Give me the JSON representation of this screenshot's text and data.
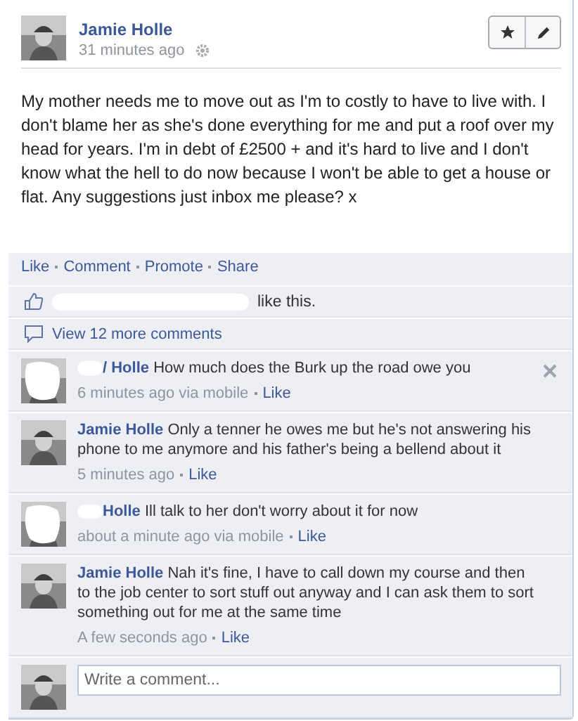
{
  "post": {
    "author": "Jamie Holle",
    "time": "31 minutes ago",
    "body": "My mother needs me to move out as I'm to costly to have to live with. I don't blame her as she's done everything for me and put a roof over my head for years. I'm in debt of £2500 + and it's hard to live and I don't know what the hell to do now because I won't be able to get a house or flat. Any suggestions just inbox me please? x"
  },
  "actions": [
    "Like",
    "Comment",
    "Promote",
    "Share"
  ],
  "likes": {
    "text": "like this."
  },
  "view_more": "View 12 more comments",
  "comments": [
    {
      "author": "/ Holle",
      "redacted": true,
      "text": "How much does the Burk up the road owe you",
      "time": "6 minutes ago via mobile",
      "like": "Like",
      "removable": true
    },
    {
      "author": "Jamie Holle",
      "redacted": false,
      "text": "Only a tenner he owes me but he's not answering his phone to me anymore and his father's being a bellend about it",
      "time": "5 minutes ago",
      "like": "Like",
      "removable": false
    },
    {
      "author": "Holle",
      "redacted": true,
      "text": "Ill talk to her don't worry about it for now",
      "time": "about a minute ago via mobile",
      "like": "Like",
      "removable": false
    },
    {
      "author": "Jamie Holle",
      "redacted": false,
      "text": "Nah it's fine, I have to call down my course and then to the job center to sort stuff out anyway and I can ask them to sort something out for me at the same time",
      "time": "A few seconds ago",
      "like": "Like",
      "removable": false
    }
  ],
  "composer": {
    "placeholder": "Write a comment..."
  }
}
